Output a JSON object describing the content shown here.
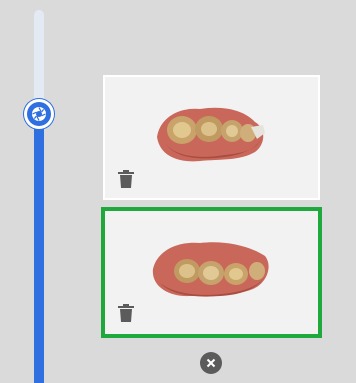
{
  "panel": {
    "slider": {
      "value_fraction": 0.72,
      "thumb_icon": "aperture-icon",
      "accent_color": "#2f6fe0"
    },
    "scans": [
      {
        "id": "upper-jaw",
        "selected": false,
        "delete_icon": "trash-icon"
      },
      {
        "id": "lower-jaw",
        "selected": true,
        "delete_icon": "trash-icon",
        "selected_border_color": "#1fa83c"
      }
    ],
    "close_icon": "close-circle-icon"
  }
}
